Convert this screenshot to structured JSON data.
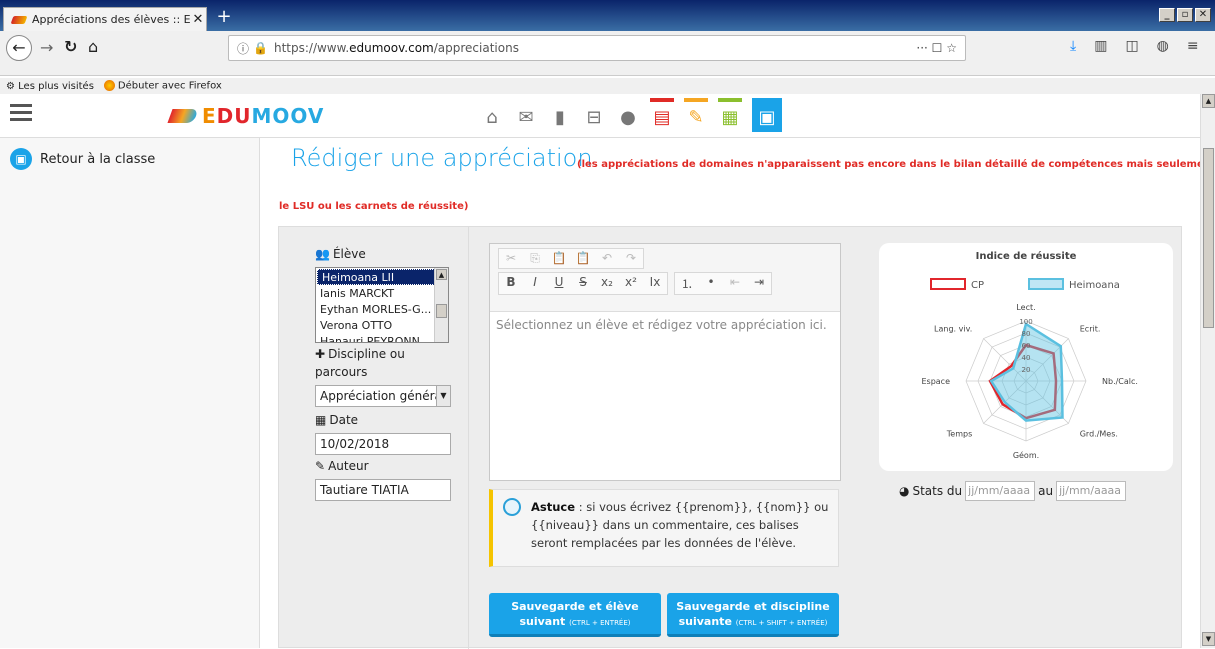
{
  "browser": {
    "tab_title": "Appréciations des élèves :: Edumo",
    "tab_close": "✕",
    "new_tab": "+",
    "url_prefix": "https://www.",
    "url_host": "edumoov.com",
    "url_path": "/appreciations",
    "url_actions": "··· ☐ ☆",
    "bookmarks": [
      "Les plus visités",
      "Débuter avec Firefox"
    ],
    "win_controls": [
      "_",
      "▫",
      "✕"
    ]
  },
  "site": {
    "logo_parts": [
      "E",
      "DU",
      "MOOV"
    ],
    "nav_icons": [
      "home-icon",
      "mail-icon",
      "book-icon",
      "cart-icon",
      "user-icon",
      "document-icon",
      "pencil-icon",
      "calendar-icon",
      "briefcase-icon"
    ]
  },
  "sidebar": {
    "back_label": "Retour à la classe"
  },
  "main": {
    "title": "Rédiger une appréciation",
    "note_line1": "(les appréciations de domaines n'apparaissent pas encore dans le bilan détaillé de compétences mais seulement dans",
    "note_line2": "le LSU ou les carnets de réussite)"
  },
  "form": {
    "student_label": "Élève",
    "students": [
      "Heimoana LII",
      "Ianis MARCKT",
      "Eythan MORLES-G...",
      "Verona OTTO",
      "Hanauri PEYRONN"
    ],
    "selected_student": "Heimoana LII",
    "discipline_label_1": "Discipline ou",
    "discipline_label_2": "parcours",
    "discipline_value": "Appréciation généra",
    "date_label": "Date",
    "date_value": "10/02/2018",
    "author_label": "Auteur",
    "author_value": "Tautiare TIATIA"
  },
  "editor": {
    "placeholder": "Sélectionnez un élève et rédigez votre appréciation ici.",
    "toolbar_row1": [
      "✂",
      "⎘",
      "📋",
      "📋",
      "↶",
      "↷"
    ],
    "toolbar_row2_format": [
      "B",
      "I",
      "U",
      "S",
      "x₂",
      "x²",
      "Ix"
    ],
    "toolbar_row2_list": [
      "⒈",
      "•",
      "⇤",
      "⇥"
    ]
  },
  "tip": {
    "bold": "Astuce",
    "text": " : si vous écrivez {{prenom}}, {{nom}} ou {{niveau}} dans un commentaire, ces balises seront remplacées par les données de l'élève."
  },
  "buttons": {
    "save_next_student_line1": "Sauvegarde et élève",
    "save_next_student_line2": "suivant",
    "save_next_student_shortcut": "(CTRL + ENTRÉE)",
    "save_next_discipline_line1": "Sauvegarde et discipline",
    "save_next_discipline_line2": "suivante",
    "save_next_discipline_shortcut": "(CTRL + SHIFT + ENTRÉE)"
  },
  "stats": {
    "label": "Stats du",
    "between": "au",
    "from_placeholder": "jj/mm/aaaa",
    "to_placeholder": "jj/mm/aaaa"
  },
  "chart_data": {
    "type": "radar",
    "title": "Indice de réussite",
    "categories": [
      "Lect.",
      "Ecrit.",
      "Nb./Calc.",
      "Grd./Mes.",
      "Géom.",
      "Temps",
      "Espace",
      "Lang. viv."
    ],
    "rlim": [
      0,
      100
    ],
    "ticks": [
      20,
      40,
      60,
      80,
      100
    ],
    "series": [
      {
        "name": "CP",
        "color": "#e1262c",
        "values": [
          60,
          65,
          50,
          68,
          62,
          55,
          60,
          35
        ]
      },
      {
        "name": "Heimoana",
        "color": "#5bc0e0",
        "values": [
          95,
          82,
          60,
          86,
          66,
          50,
          58,
          30
        ]
      }
    ]
  }
}
